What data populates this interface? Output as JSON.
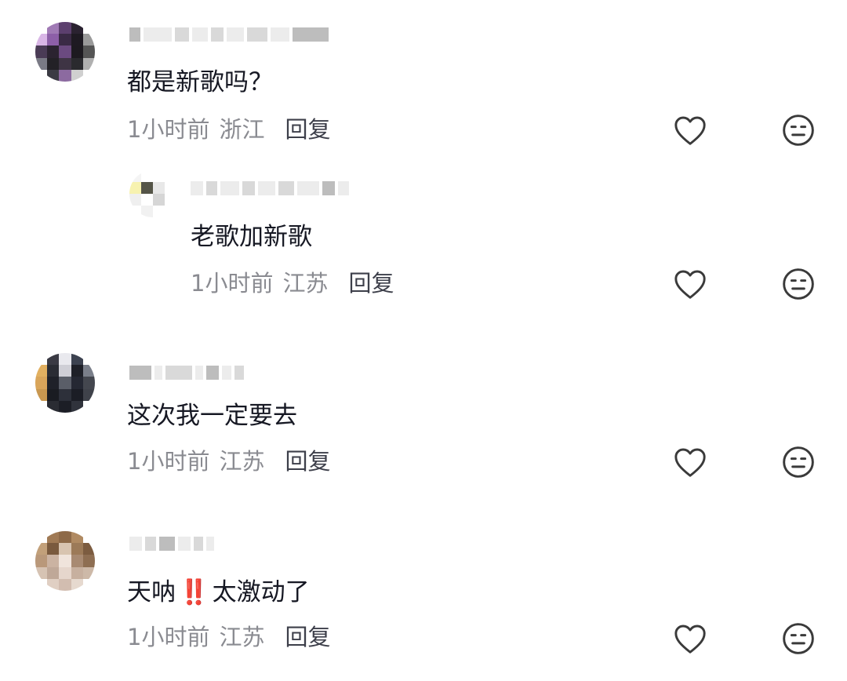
{
  "comments": [
    {
      "text": "都是新歌吗？",
      "time": "1小时前",
      "location": "浙江",
      "reply_label": "回复"
    },
    {
      "text": "老歌加新歌",
      "time": "1小时前",
      "location": "江苏",
      "reply_label": "回复",
      "is_reply": true
    },
    {
      "text": "这次我一定要去",
      "time": "1小时前",
      "location": "江苏",
      "reply_label": "回复"
    },
    {
      "text_before": "天呐",
      "emoji": "‼️",
      "text_after": "太激动了",
      "time": "1小时前",
      "location": "江苏",
      "reply_label": "回复"
    }
  ],
  "icons": {
    "like": "heart-outline-icon",
    "dislike": "neutral-face-icon"
  },
  "colors": {
    "text": "#161823",
    "meta": "#8a8b91",
    "reply": "#3d3f4a",
    "icon": "#3a3a3a",
    "emoji": "#e8211e"
  }
}
